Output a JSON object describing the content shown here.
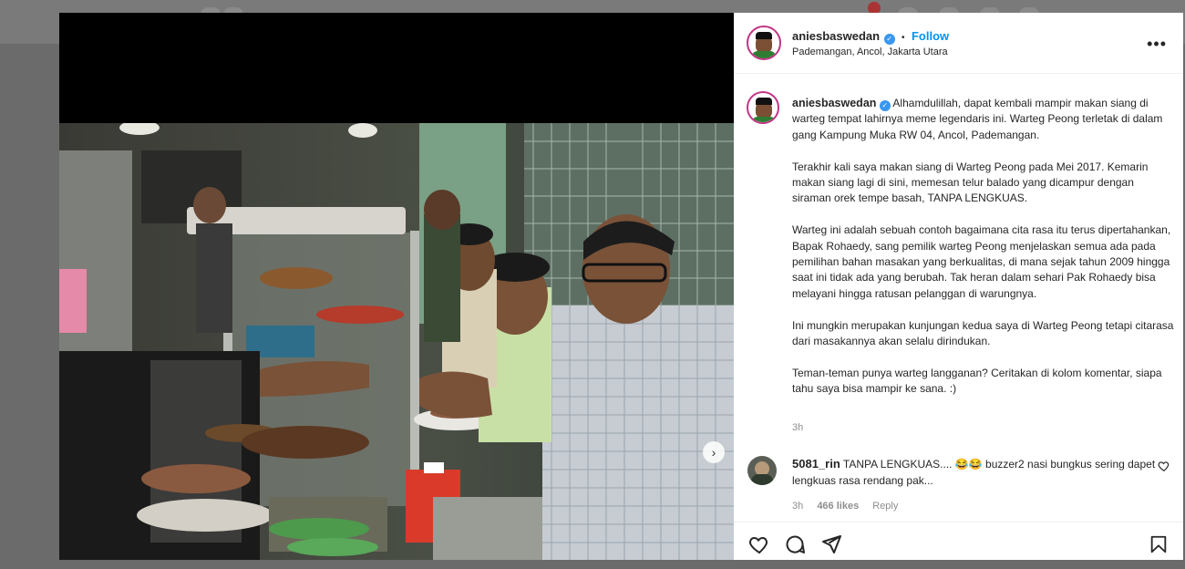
{
  "post": {
    "username": "aniesbaswedan",
    "follow_label": "Follow",
    "separator": "•",
    "location": "Pademangan, Ancol, Jakarta Utara",
    "more_label": "•••",
    "caption_paragraphs": [
      "Alhamdulillah, dapat kembali mampir makan siang di warteg tempat lahirnya meme legendaris ini. Warteg Peong terletak di dalam gang Kampung Muka RW 04, Ancol, Pademangan.",
      "Terakhir kali saya makan siang di Warteg Peong pada Mei 2017. Kemarin makan siang lagi di sini, memesan telur balado yang dicampur dengan siraman orek tempe basah, TANPA LENGKUAS.",
      "Warteg ini adalah sebuah contoh bagaimana cita rasa itu terus dipertahankan, Bapak Rohaedy, sang pemilik warteg Peong menjelaskan semua ada pada pemilihan bahan masakan yang berkualitas, di mana sejak tahun 2009 hingga saat ini tidak ada yang berubah. Tak heran dalam sehari Pak Rohaedy bisa melayani hingga ratusan pelanggan di warungnya.",
      "Ini mungkin merupakan kunjungan kedua saya di Warteg Peong tetapi citarasa dari masakannya akan selalu dirindukan.",
      "Teman-teman punya warteg langganan? Ceritakan di kolom komentar, siapa tahu saya bisa mampir ke sana. :)"
    ],
    "time_ago": "3h"
  },
  "comment": {
    "username": "5081_rin",
    "text": "TANPA LENGKUAS.... 😂😂 buzzer2 nasi bungkus sering dapet lengkuas rasa rendang pak...",
    "time_ago": "3h",
    "likes": "466 likes",
    "reply_label": "Reply"
  },
  "icons": {
    "verified": "verified-badge-icon",
    "like": "heart-icon",
    "comment": "comment-icon",
    "share": "paper-plane-icon",
    "save": "bookmark-icon",
    "next": "chevron-right-icon"
  },
  "colors": {
    "follow": "#0095f6",
    "verified": "#3897f0",
    "modal_bg": "#000000",
    "panel_bg": "#ffffff",
    "muted_text": "#8e8e8e"
  }
}
